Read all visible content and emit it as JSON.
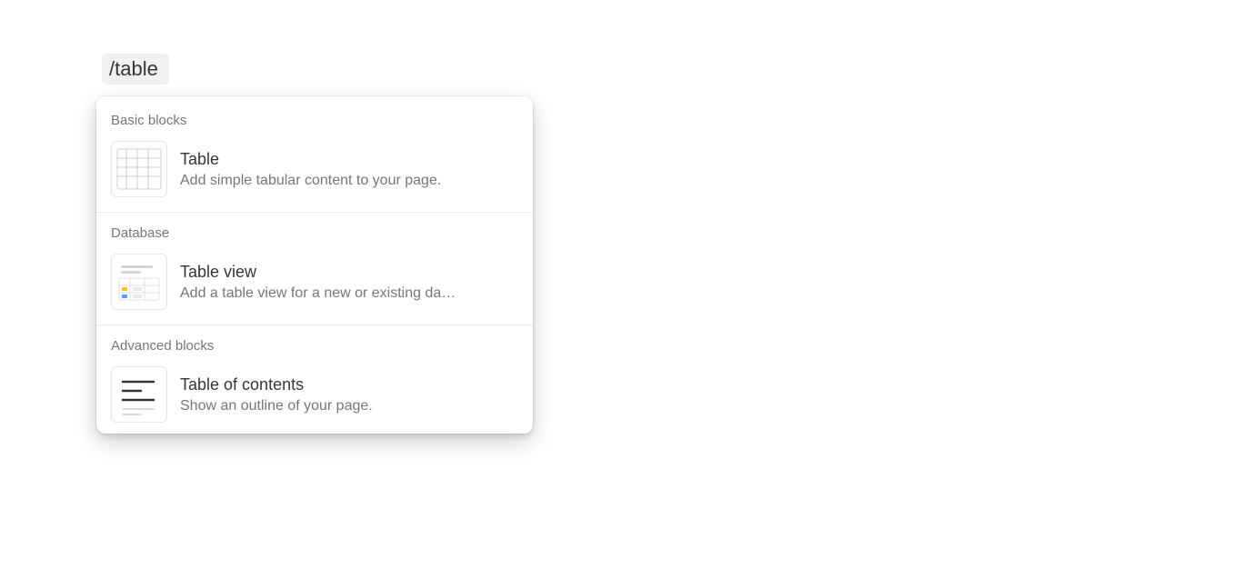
{
  "command": {
    "value": "/table"
  },
  "menu": {
    "sections": [
      {
        "header": "Basic blocks",
        "items": [
          {
            "title": "Table",
            "description": "Add simple tabular content to your page.",
            "icon": "table-grid"
          }
        ]
      },
      {
        "header": "Database",
        "items": [
          {
            "title": "Table view",
            "description": "Add a table view for a new or existing da…",
            "icon": "table-view"
          }
        ]
      },
      {
        "header": "Advanced blocks",
        "items": [
          {
            "title": "Table of contents",
            "description": "Show an outline of your page.",
            "icon": "toc"
          }
        ]
      }
    ]
  }
}
